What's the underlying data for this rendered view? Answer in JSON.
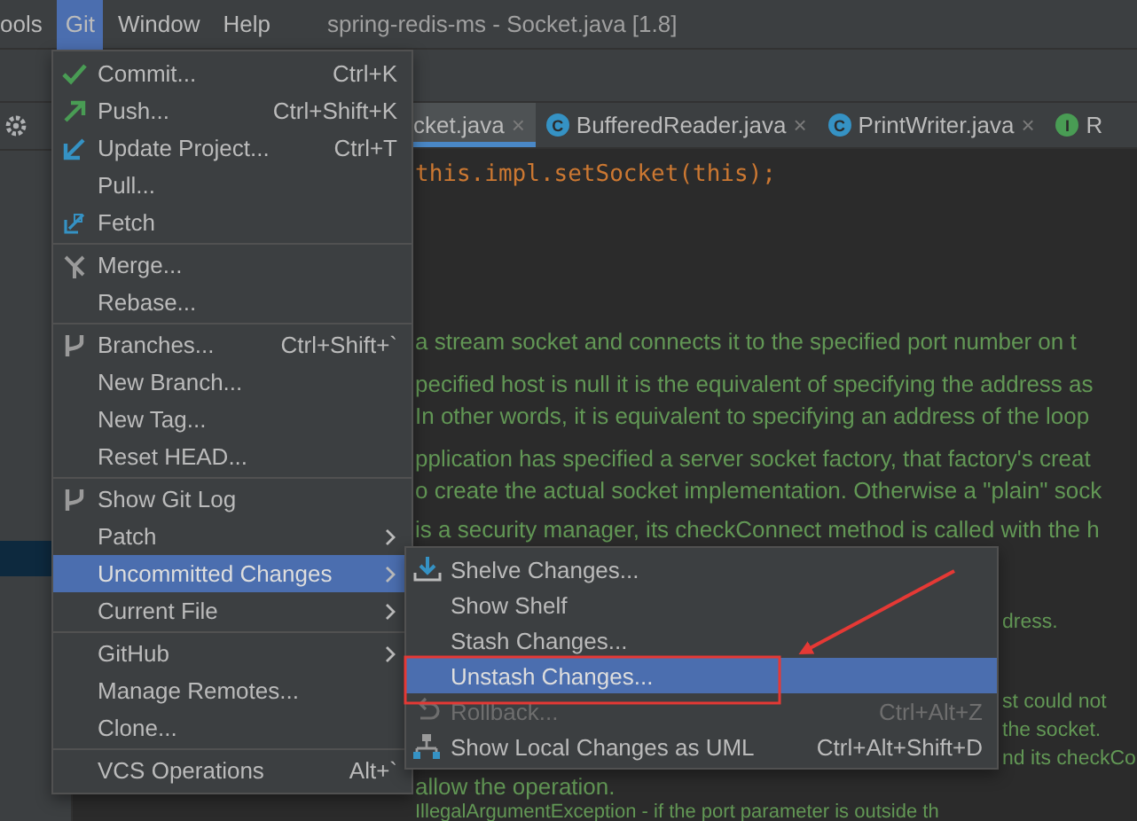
{
  "menubar": [
    {
      "label": "ools",
      "selected": false
    },
    {
      "label": "Git",
      "selected": true
    },
    {
      "label": "Window",
      "selected": false
    },
    {
      "label": "Help",
      "selected": false
    }
  ],
  "window": {
    "title": "spring-redis-ms - Socket.java [1.8]"
  },
  "tabs": [
    {
      "label": "cket.java",
      "selected": true,
      "close": "×"
    },
    {
      "label": "BufferedReader.java",
      "selected": false,
      "badge": "C",
      "color": "#3592c4",
      "close": "×"
    },
    {
      "label": "PrintWriter.java",
      "selected": false,
      "badge": "C",
      "color": "#3592c4",
      "close": "×"
    },
    {
      "label": "R",
      "selected": false,
      "badge": "I",
      "color": "#499c54"
    }
  ],
  "editor": {
    "code": "this.impl.setSocket(this);",
    "paragraphs": [
      [
        "a stream socket and connects it to the specified port number on t"
      ],
      [
        "pecified host is null it is the equivalent of specifying the address as",
        "In other words, it is equivalent to specifying an address of the loop"
      ],
      [
        "pplication has specified a server socket factory, that factory's creat",
        "o create the actual socket implementation. Otherwise a \"plain\" sock"
      ],
      [
        "is a security manager, its checkConnect method is called with the h"
      ],
      [
        "dress."
      ],
      [
        "st could not",
        "the socket.",
        "nd its checkCo",
        "allow the operation."
      ],
      [
        "IllegalArgumentException - if the port parameter is outside th"
      ]
    ]
  },
  "git_menu": [
    {
      "kind": "commit",
      "label": "Commit...",
      "shortcut": "Ctrl+K",
      "selected": false
    },
    {
      "kind": "push",
      "label": "Push...",
      "shortcut": "Ctrl+Shift+K",
      "selected": false
    },
    {
      "kind": "update",
      "label": "Update Project...",
      "shortcut": "Ctrl+T",
      "selected": false
    },
    {
      "kind": "plain",
      "label": "Pull...",
      "selected": false
    },
    {
      "kind": "fetch",
      "label": "Fetch",
      "selected": false
    },
    {
      "kind": "separator"
    },
    {
      "kind": "merge",
      "label": "Merge...",
      "selected": false
    },
    {
      "kind": "plain",
      "label": "Rebase...",
      "selected": false
    },
    {
      "kind": "separator"
    },
    {
      "kind": "branch",
      "label": "Branches...",
      "shortcut": "Ctrl+Shift+`",
      "selected": false
    },
    {
      "kind": "plain",
      "label": "New Branch...",
      "selected": false
    },
    {
      "kind": "plain",
      "label": "New Tag...",
      "selected": false
    },
    {
      "kind": "plain",
      "label": "Reset HEAD...",
      "selected": false
    },
    {
      "kind": "separator"
    },
    {
      "kind": "log",
      "label": "Show Git Log",
      "selected": false
    },
    {
      "kind": "plain",
      "label": "Patch",
      "submenu": true,
      "selected": false
    },
    {
      "kind": "plain",
      "label": "Uncommitted Changes",
      "submenu": true,
      "selected": true
    },
    {
      "kind": "plain",
      "label": "Current File",
      "submenu": true,
      "selected": false
    },
    {
      "kind": "separator"
    },
    {
      "kind": "plain",
      "label": "GitHub",
      "submenu": true,
      "selected": false
    },
    {
      "kind": "plain",
      "label": "Manage Remotes...",
      "selected": false
    },
    {
      "kind": "plain",
      "label": "Clone...",
      "selected": false
    },
    {
      "kind": "separator"
    },
    {
      "kind": "plain",
      "label": "VCS Operations",
      "shortcut": "Alt+`",
      "selected": false
    }
  ],
  "uncommitted_menu": [
    {
      "kind": "shelve",
      "label": "Shelve Changes...",
      "selected": false
    },
    {
      "kind": "plain",
      "label": "Show Shelf",
      "selected": false
    },
    {
      "kind": "plain",
      "label": "Stash Changes...",
      "selected": false
    },
    {
      "kind": "plain",
      "label": "Unstash Changes...",
      "selected": true
    },
    {
      "kind": "rollback",
      "label": "Rollback...",
      "shortcut": "Ctrl+Alt+Z",
      "disabled": true,
      "selected": false
    },
    {
      "kind": "uml",
      "label": "Show Local Changes as UML",
      "shortcut": "Ctrl+Alt+Shift+D",
      "selected": false
    }
  ]
}
